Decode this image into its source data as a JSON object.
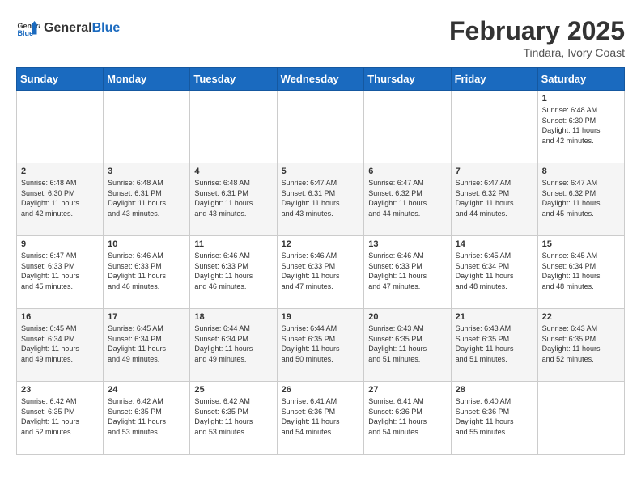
{
  "logo": {
    "text_general": "General",
    "text_blue": "Blue"
  },
  "header": {
    "month": "February 2025",
    "location": "Tindara, Ivory Coast"
  },
  "days_of_week": [
    "Sunday",
    "Monday",
    "Tuesday",
    "Wednesday",
    "Thursday",
    "Friday",
    "Saturday"
  ],
  "weeks": [
    {
      "days": [
        {
          "num": "",
          "info": ""
        },
        {
          "num": "",
          "info": ""
        },
        {
          "num": "",
          "info": ""
        },
        {
          "num": "",
          "info": ""
        },
        {
          "num": "",
          "info": ""
        },
        {
          "num": "",
          "info": ""
        },
        {
          "num": "1",
          "info": "Sunrise: 6:48 AM\nSunset: 6:30 PM\nDaylight: 11 hours\nand 42 minutes."
        }
      ]
    },
    {
      "days": [
        {
          "num": "2",
          "info": "Sunrise: 6:48 AM\nSunset: 6:30 PM\nDaylight: 11 hours\nand 42 minutes."
        },
        {
          "num": "3",
          "info": "Sunrise: 6:48 AM\nSunset: 6:31 PM\nDaylight: 11 hours\nand 43 minutes."
        },
        {
          "num": "4",
          "info": "Sunrise: 6:48 AM\nSunset: 6:31 PM\nDaylight: 11 hours\nand 43 minutes."
        },
        {
          "num": "5",
          "info": "Sunrise: 6:47 AM\nSunset: 6:31 PM\nDaylight: 11 hours\nand 43 minutes."
        },
        {
          "num": "6",
          "info": "Sunrise: 6:47 AM\nSunset: 6:32 PM\nDaylight: 11 hours\nand 44 minutes."
        },
        {
          "num": "7",
          "info": "Sunrise: 6:47 AM\nSunset: 6:32 PM\nDaylight: 11 hours\nand 44 minutes."
        },
        {
          "num": "8",
          "info": "Sunrise: 6:47 AM\nSunset: 6:32 PM\nDaylight: 11 hours\nand 45 minutes."
        }
      ]
    },
    {
      "days": [
        {
          "num": "9",
          "info": "Sunrise: 6:47 AM\nSunset: 6:33 PM\nDaylight: 11 hours\nand 45 minutes."
        },
        {
          "num": "10",
          "info": "Sunrise: 6:46 AM\nSunset: 6:33 PM\nDaylight: 11 hours\nand 46 minutes."
        },
        {
          "num": "11",
          "info": "Sunrise: 6:46 AM\nSunset: 6:33 PM\nDaylight: 11 hours\nand 46 minutes."
        },
        {
          "num": "12",
          "info": "Sunrise: 6:46 AM\nSunset: 6:33 PM\nDaylight: 11 hours\nand 47 minutes."
        },
        {
          "num": "13",
          "info": "Sunrise: 6:46 AM\nSunset: 6:33 PM\nDaylight: 11 hours\nand 47 minutes."
        },
        {
          "num": "14",
          "info": "Sunrise: 6:45 AM\nSunset: 6:34 PM\nDaylight: 11 hours\nand 48 minutes."
        },
        {
          "num": "15",
          "info": "Sunrise: 6:45 AM\nSunset: 6:34 PM\nDaylight: 11 hours\nand 48 minutes."
        }
      ]
    },
    {
      "days": [
        {
          "num": "16",
          "info": "Sunrise: 6:45 AM\nSunset: 6:34 PM\nDaylight: 11 hours\nand 49 minutes."
        },
        {
          "num": "17",
          "info": "Sunrise: 6:45 AM\nSunset: 6:34 PM\nDaylight: 11 hours\nand 49 minutes."
        },
        {
          "num": "18",
          "info": "Sunrise: 6:44 AM\nSunset: 6:34 PM\nDaylight: 11 hours\nand 49 minutes."
        },
        {
          "num": "19",
          "info": "Sunrise: 6:44 AM\nSunset: 6:35 PM\nDaylight: 11 hours\nand 50 minutes."
        },
        {
          "num": "20",
          "info": "Sunrise: 6:43 AM\nSunset: 6:35 PM\nDaylight: 11 hours\nand 51 minutes."
        },
        {
          "num": "21",
          "info": "Sunrise: 6:43 AM\nSunset: 6:35 PM\nDaylight: 11 hours\nand 51 minutes."
        },
        {
          "num": "22",
          "info": "Sunrise: 6:43 AM\nSunset: 6:35 PM\nDaylight: 11 hours\nand 52 minutes."
        }
      ]
    },
    {
      "days": [
        {
          "num": "23",
          "info": "Sunrise: 6:42 AM\nSunset: 6:35 PM\nDaylight: 11 hours\nand 52 minutes."
        },
        {
          "num": "24",
          "info": "Sunrise: 6:42 AM\nSunset: 6:35 PM\nDaylight: 11 hours\nand 53 minutes."
        },
        {
          "num": "25",
          "info": "Sunrise: 6:42 AM\nSunset: 6:35 PM\nDaylight: 11 hours\nand 53 minutes."
        },
        {
          "num": "26",
          "info": "Sunrise: 6:41 AM\nSunset: 6:36 PM\nDaylight: 11 hours\nand 54 minutes."
        },
        {
          "num": "27",
          "info": "Sunrise: 6:41 AM\nSunset: 6:36 PM\nDaylight: 11 hours\nand 54 minutes."
        },
        {
          "num": "28",
          "info": "Sunrise: 6:40 AM\nSunset: 6:36 PM\nDaylight: 11 hours\nand 55 minutes."
        },
        {
          "num": "",
          "info": ""
        }
      ]
    }
  ]
}
